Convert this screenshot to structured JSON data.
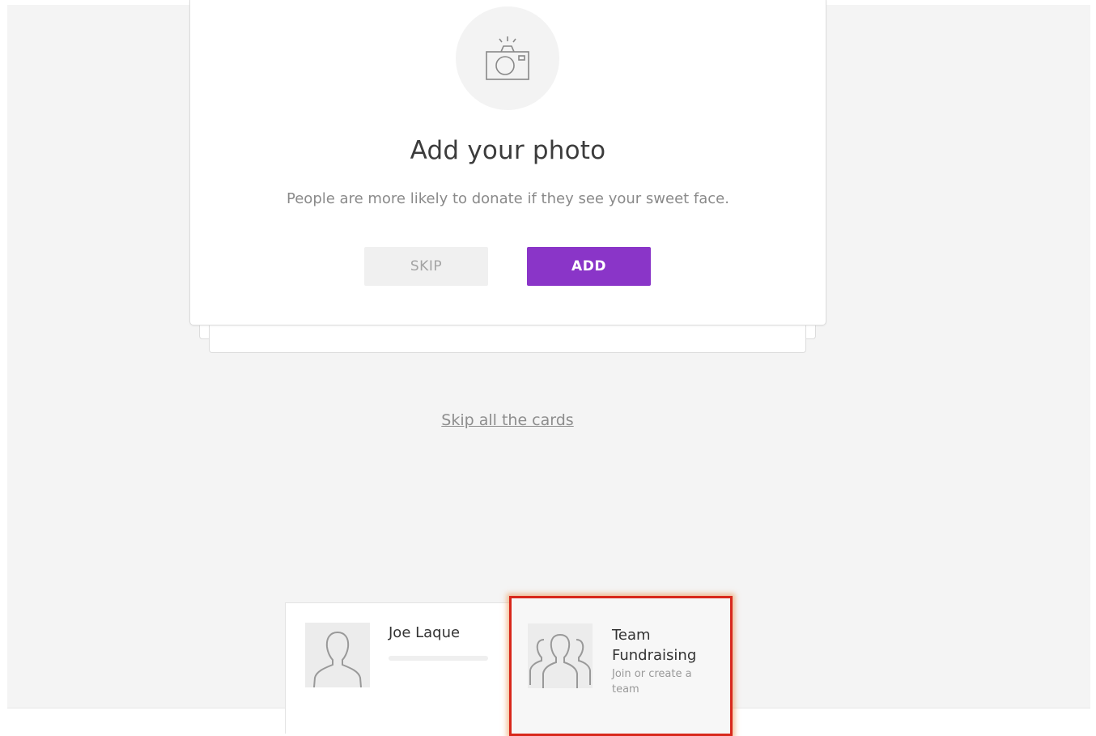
{
  "photo_card": {
    "icon": "camera-icon",
    "title": "Add your photo",
    "subtitle": "People are more likely to donate if they see your sweet face.",
    "skip_label": "SKIP",
    "add_label": "ADD"
  },
  "skip_all_link": "Skip all the cards",
  "profile": {
    "name": "Joe Laque",
    "avatar_icon": "person-silhouette-icon",
    "progress": 0
  },
  "team": {
    "title": "Team Fundraising",
    "description": "Join or create a team",
    "icon": "group-silhouette-icon"
  },
  "colors": {
    "accent": "#8a35c8",
    "highlight_border": "#d8281c",
    "background": "#f4f4f4"
  }
}
